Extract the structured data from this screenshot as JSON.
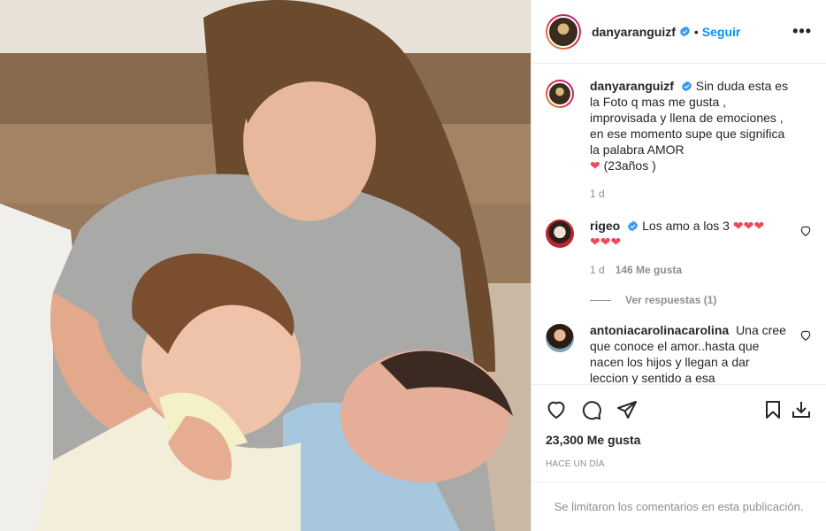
{
  "header": {
    "username": "danyaranguizf",
    "follow_label": "Seguir",
    "dot": "•",
    "more_label": "•••"
  },
  "caption": {
    "username": "danyaranguizf",
    "text": "Sin duda esta es la Foto q mas me gusta , improvisada y llena de emociones , en ese momento supe que significa la palabra AMOR",
    "text_tail": "(23años )",
    "time": "1 d"
  },
  "comments": [
    {
      "username": "rigeo",
      "text": "Los amo a los 3",
      "time": "1 d",
      "likes": "146 Me gusta",
      "replies": "Ver respuestas (1)"
    },
    {
      "username": "antoniacarolinacarolina",
      "text": "Una cree que conoce el amor..hasta que nacen los hijos y llegan a dar leccion y sentido a esa palabra,saludos"
    }
  ],
  "actions": {
    "likes": "23,300 Me gusta",
    "date": "HACE UN DÍA"
  },
  "footer": {
    "text": "Se limitaron los comentarios en esta publicación."
  },
  "colors": {
    "accent": "#0095f6",
    "verified": "#3897f0",
    "heart": "#ed4956",
    "muted": "#8e8e8e"
  },
  "icons": [
    "heart-icon",
    "comment-icon",
    "share-icon",
    "bookmark-icon",
    "download-icon",
    "verified-icon",
    "more-icon"
  ]
}
